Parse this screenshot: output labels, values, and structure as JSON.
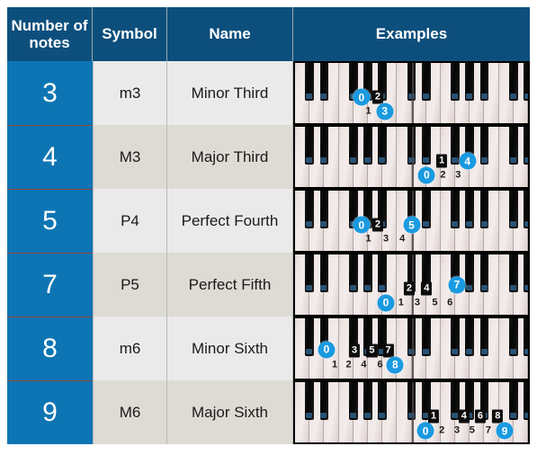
{
  "table": {
    "headers": {
      "number_of_notes": "Number of notes",
      "symbol": "Symbol",
      "name": "Name",
      "examples": "Examples"
    },
    "colors": {
      "header_bg": "#0d4f7c",
      "number_cell_bg": "#0d75b3",
      "row_odd_bg": "#eaeaea",
      "row_even_bg": "#dedbd4",
      "marker_accent": "#1a9ae0",
      "text": "#1a1a1a"
    },
    "rows": [
      {
        "number": "3",
        "symbol": "m3",
        "name": "Minor Third",
        "keyboard": {
          "markers": [
            {
              "label": "0",
              "style": "circle",
              "x": 28.5,
              "y": 57
            },
            {
              "label": "2",
              "style": "onblack",
              "x": 35.5,
              "y": 57
            },
            {
              "label": "1",
              "style": "onwhite",
              "x": 31.5,
              "y": 80
            },
            {
              "label": "3",
              "style": "circle",
              "x": 38.5,
              "y": 80
            }
          ]
        }
      },
      {
        "number": "4",
        "symbol": "M3",
        "name": "Major Third",
        "keyboard": {
          "markers": [
            {
              "label": "0",
              "style": "circle",
              "x": 56.5,
              "y": 80
            },
            {
              "label": "1",
              "style": "onblack",
              "x": 63.0,
              "y": 57
            },
            {
              "label": "2",
              "style": "onwhite",
              "x": 63.5,
              "y": 80
            },
            {
              "label": "3",
              "style": "onwhite",
              "x": 70.0,
              "y": 80
            },
            {
              "label": "4",
              "style": "circle",
              "x": 74.0,
              "y": 57
            }
          ]
        }
      },
      {
        "number": "5",
        "symbol": "P4",
        "name": "Perfect Fourth",
        "keyboard": {
          "markers": [
            {
              "label": "0",
              "style": "circle",
              "x": 28.5,
              "y": 57
            },
            {
              "label": "2",
              "style": "onblack",
              "x": 35.5,
              "y": 57
            },
            {
              "label": "1",
              "style": "onwhite",
              "x": 31.5,
              "y": 80
            },
            {
              "label": "3",
              "style": "onwhite",
              "x": 39.0,
              "y": 80
            },
            {
              "label": "4",
              "style": "onwhite",
              "x": 46.0,
              "y": 80
            },
            {
              "label": "5",
              "style": "circle",
              "x": 50.0,
              "y": 57
            }
          ]
        }
      },
      {
        "number": "7",
        "symbol": "P5",
        "name": "Perfect Fifth",
        "keyboard": {
          "markers": [
            {
              "label": "0",
              "style": "circle",
              "x": 39.0,
              "y": 80
            },
            {
              "label": "1",
              "style": "onwhite",
              "x": 45.5,
              "y": 80
            },
            {
              "label": "2",
              "style": "onblack",
              "x": 49.0,
              "y": 57
            },
            {
              "label": "3",
              "style": "onwhite",
              "x": 52.5,
              "y": 80
            },
            {
              "label": "4",
              "style": "onblack",
              "x": 56.5,
              "y": 57
            },
            {
              "label": "5",
              "style": "onwhite",
              "x": 60.0,
              "y": 80
            },
            {
              "label": "6",
              "style": "onwhite",
              "x": 66.5,
              "y": 80
            },
            {
              "label": "7",
              "style": "circle",
              "x": 69.5,
              "y": 50
            }
          ]
        }
      },
      {
        "number": "8",
        "symbol": "m6",
        "name": "Minor Sixth",
        "keyboard": {
          "markers": [
            {
              "label": "0",
              "style": "circle",
              "x": 13.5,
              "y": 52
            },
            {
              "label": "1",
              "style": "onwhite",
              "x": 17.0,
              "y": 77
            },
            {
              "label": "2",
              "style": "onwhite",
              "x": 23.0,
              "y": 77
            },
            {
              "label": "3",
              "style": "onblack",
              "x": 25.5,
              "y": 54
            },
            {
              "label": "4",
              "style": "onwhite",
              "x": 29.5,
              "y": 77
            },
            {
              "label": "5",
              "style": "onblack",
              "x": 33.0,
              "y": 54
            },
            {
              "label": "6",
              "style": "onwhite",
              "x": 36.5,
              "y": 77
            },
            {
              "label": "7",
              "style": "onblack",
              "x": 40.0,
              "y": 54
            },
            {
              "label": "8",
              "style": "circle",
              "x": 43.0,
              "y": 77
            }
          ]
        }
      },
      {
        "number": "9",
        "symbol": "M6",
        "name": "Major Sixth",
        "keyboard": {
          "markers": [
            {
              "label": "0",
              "style": "circle",
              "x": 56.0,
              "y": 81
            },
            {
              "label": "1",
              "style": "onblack",
              "x": 59.5,
              "y": 57
            },
            {
              "label": "2",
              "style": "onwhite",
              "x": 63.0,
              "y": 81
            },
            {
              "label": "3",
              "style": "onwhite",
              "x": 69.5,
              "y": 81
            },
            {
              "label": "4",
              "style": "onblack",
              "x": 72.5,
              "y": 57
            },
            {
              "label": "5",
              "style": "onwhite",
              "x": 76.0,
              "y": 81
            },
            {
              "label": "6",
              "style": "onblack",
              "x": 79.5,
              "y": 57
            },
            {
              "label": "7",
              "style": "onwhite",
              "x": 83.0,
              "y": 81
            },
            {
              "label": "8",
              "style": "onblack",
              "x": 87.0,
              "y": 57
            },
            {
              "label": "9",
              "style": "circle",
              "x": 90.0,
              "y": 81
            }
          ]
        }
      }
    ]
  }
}
